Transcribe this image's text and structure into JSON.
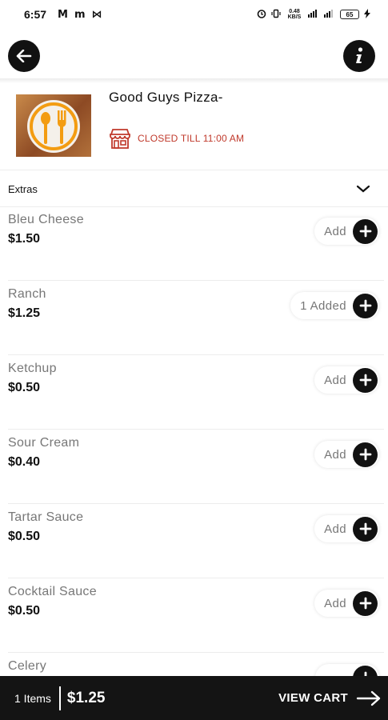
{
  "status_bar": {
    "time": "6:57",
    "app_icons": [
      "M",
      "m",
      "⋈"
    ],
    "network_speed": "0.48 KB/S",
    "battery": "65"
  },
  "nav": {
    "back_icon": "arrow-left-icon",
    "info_icon": "info-icon"
  },
  "restaurant": {
    "name": "Good Guys Pizza-",
    "status": "CLOSED TILL 11:00 AM",
    "status_color": "#c0392b"
  },
  "category": {
    "label": "Extras",
    "icon": "chevron-down-icon"
  },
  "items": [
    {
      "name": "Bleu Cheese",
      "price": "$1.50",
      "action": "Add"
    },
    {
      "name": "Ranch",
      "price": "$1.25",
      "action": "1 Added"
    },
    {
      "name": "Ketchup",
      "price": "$0.50",
      "action": "Add"
    },
    {
      "name": "Sour Cream",
      "price": "$0.40",
      "action": "Add"
    },
    {
      "name": "Tartar Sauce",
      "price": "$0.50",
      "action": "Add"
    },
    {
      "name": "Cocktail Sauce",
      "price": "$0.50",
      "action": "Add"
    },
    {
      "name": "Celery",
      "price": "",
      "action": ""
    }
  ],
  "cart": {
    "count_label": "1 Items",
    "total": "$1.25",
    "view_cart_label": "VIEW CART",
    "background": "#141414"
  }
}
